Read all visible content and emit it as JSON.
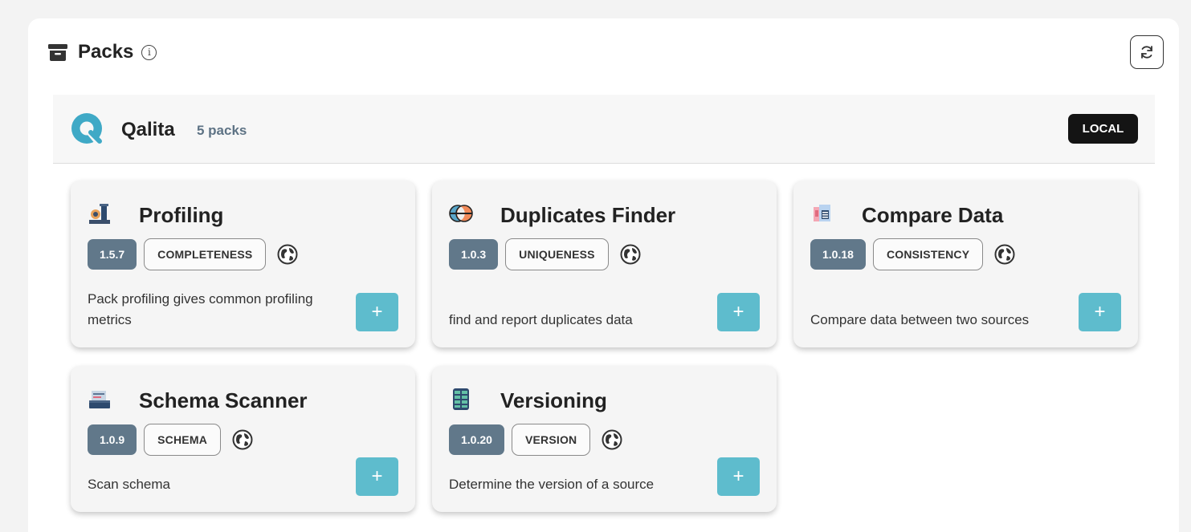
{
  "panel": {
    "title": "Packs",
    "title_icon": "archive-icon",
    "info_icon": "info-icon",
    "info_glyph": "i",
    "refresh_icon": "refresh-icon"
  },
  "provider": {
    "name": "Qalita",
    "count": "5 packs",
    "badge": "LOCAL",
    "brand_color": "#3fa9c6"
  },
  "packs": [
    {
      "icon": "profiling-icon",
      "title": "Profiling",
      "version": "1.5.7",
      "dimension": "COMPLETENESS",
      "visibility_icon": "globe-icon",
      "description": "Pack profiling gives common profiling metrics",
      "add_label": "+"
    },
    {
      "icon": "duplicates-icon",
      "title": "Duplicates Finder",
      "version": "1.0.3",
      "dimension": "UNIQUENESS",
      "visibility_icon": "globe-icon",
      "description": "find and report duplicates data",
      "add_label": "+"
    },
    {
      "icon": "compare-icon",
      "title": "Compare Data",
      "version": "1.0.18",
      "dimension": "CONSISTENCY",
      "visibility_icon": "globe-icon",
      "description": "Compare data between two sources",
      "add_label": "+"
    },
    {
      "icon": "scanner-icon",
      "title": "Schema Scanner",
      "version": "1.0.9",
      "dimension": "SCHEMA",
      "visibility_icon": "globe-icon",
      "description": "Scan schema",
      "add_label": "+"
    },
    {
      "icon": "database-icon",
      "title": "Versioning",
      "version": "1.0.20",
      "dimension": "VERSION",
      "visibility_icon": "globe-icon",
      "description": "Determine the version of a source",
      "add_label": "+"
    }
  ],
  "colors": {
    "version_badge": "#61788a",
    "add_button": "#5ebccd",
    "local_badge": "#141414"
  }
}
